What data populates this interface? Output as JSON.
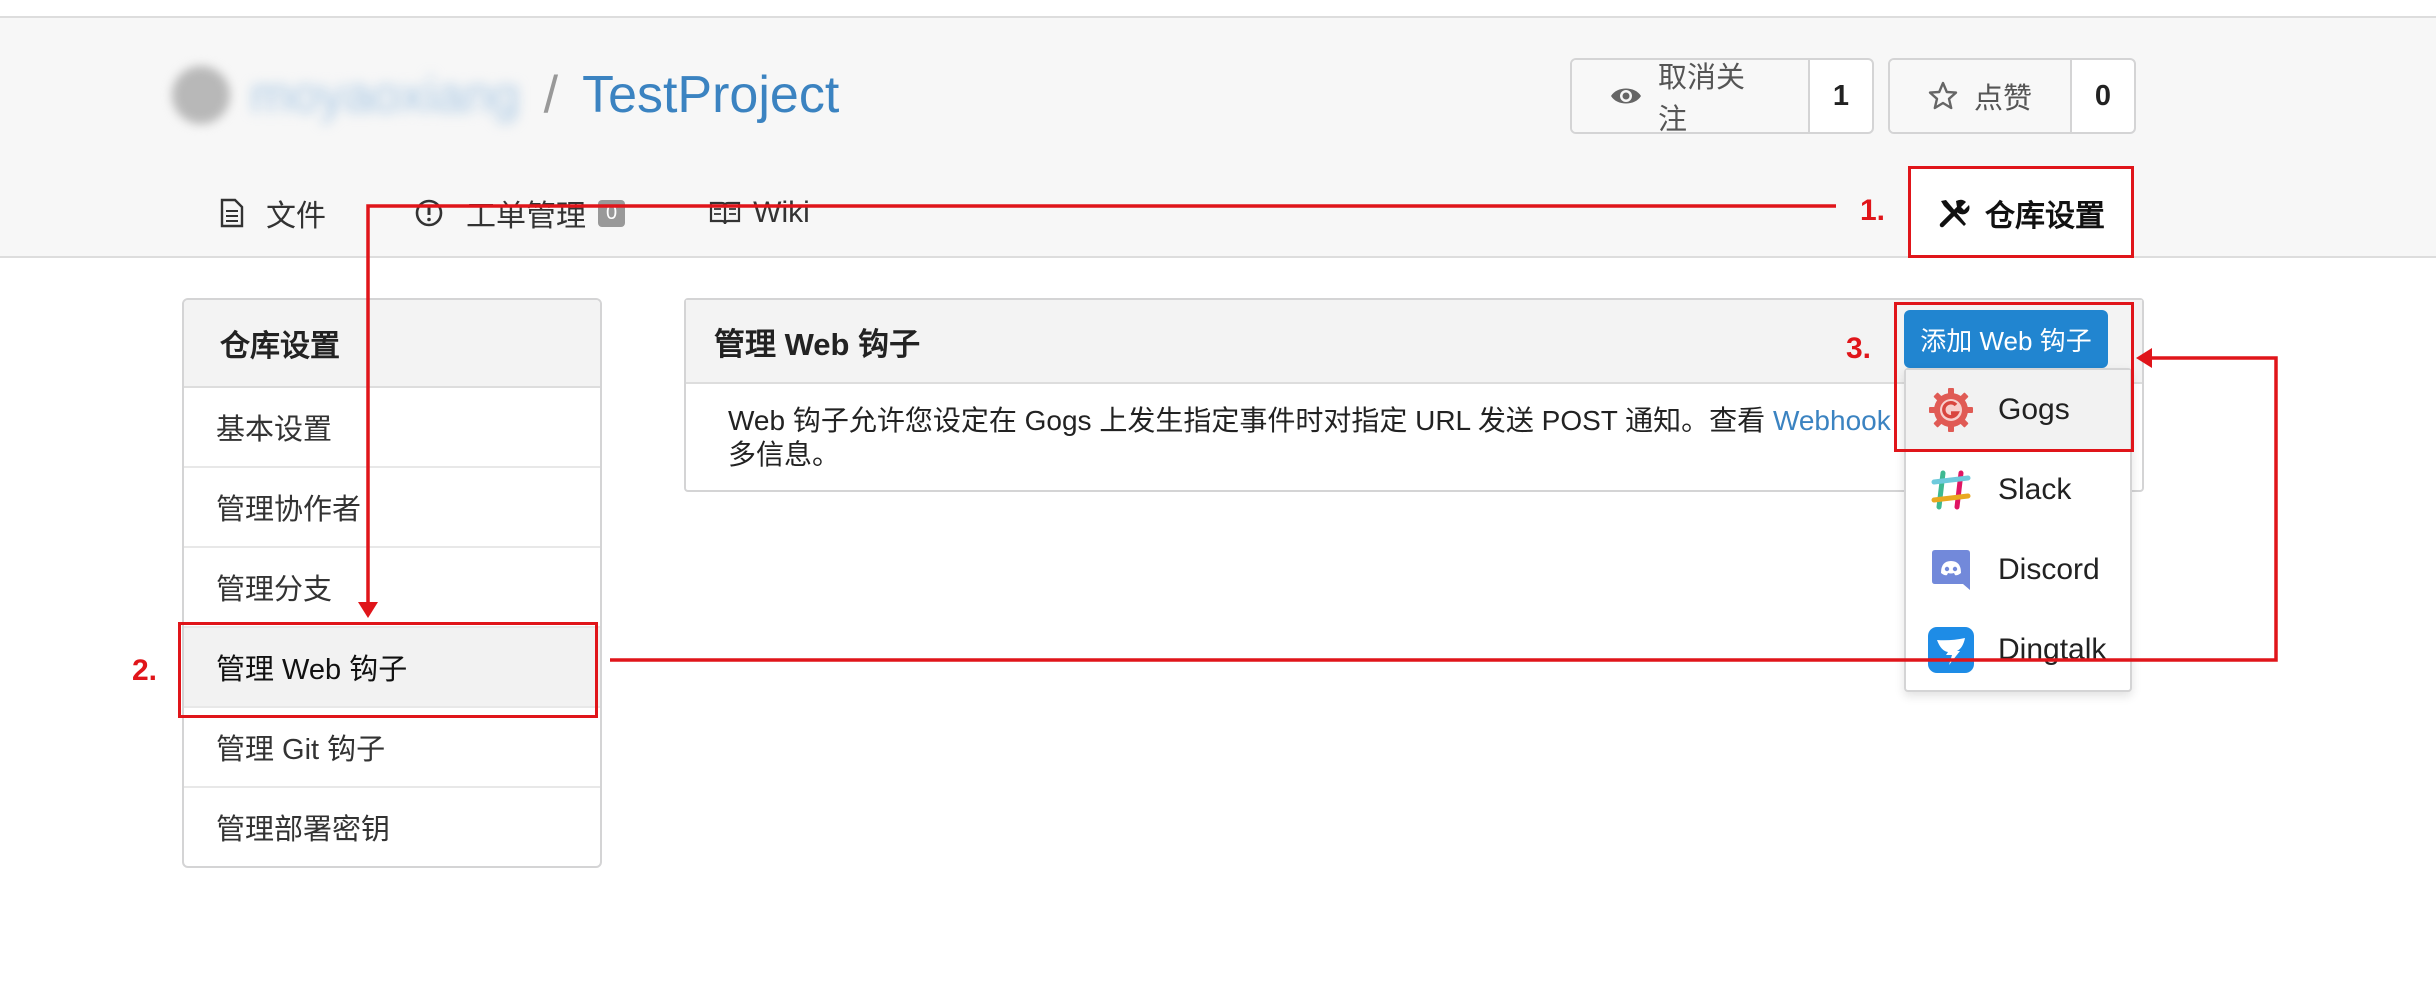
{
  "header": {
    "owner": "moyaoxiang",
    "separator": "/",
    "repo": "TestProject",
    "watch": {
      "label": "取消关注",
      "count": "1",
      "icon": "eye-icon"
    },
    "star": {
      "label": "点赞",
      "count": "0",
      "icon": "star-icon"
    }
  },
  "tabs": [
    {
      "label": "文件",
      "icon": "file-icon"
    },
    {
      "label": "工单管理",
      "icon": "issue-icon",
      "badge": "0"
    },
    {
      "label": "Wiki",
      "icon": "book-icon"
    }
  ],
  "settings_tab": {
    "label": "仓库设置",
    "icon": "tools-icon"
  },
  "sidebar": {
    "title": "仓库设置",
    "items": [
      {
        "label": "基本设置"
      },
      {
        "label": "管理协作者"
      },
      {
        "label": "管理分支"
      },
      {
        "label": "管理 Web 钩子"
      },
      {
        "label": "管理 Git 钩子"
      },
      {
        "label": "管理部署密钥"
      }
    ]
  },
  "panel": {
    "title": "管理 Web 钩子",
    "desc_line1": "Web 钩子允许您设定在 Gogs 上发生指定事件时对指定 URL 发送 POST 通知。查看",
    "desc_link": "Webhook",
    "desc_line2": "多信息。"
  },
  "add_webhook": {
    "label": "添加 Web 钩子",
    "options": [
      {
        "label": "Gogs",
        "icon": "gogs-icon"
      },
      {
        "label": "Slack",
        "icon": "slack-icon"
      },
      {
        "label": "Discord",
        "icon": "discord-icon"
      },
      {
        "label": "Dingtalk",
        "icon": "dingtalk-icon"
      }
    ]
  },
  "annotations": {
    "step1": "1.",
    "step2": "2.",
    "step3": "3."
  },
  "colors": {
    "accent": "#2185d0",
    "link": "#3b83c1",
    "annotation": "#e0151a"
  }
}
